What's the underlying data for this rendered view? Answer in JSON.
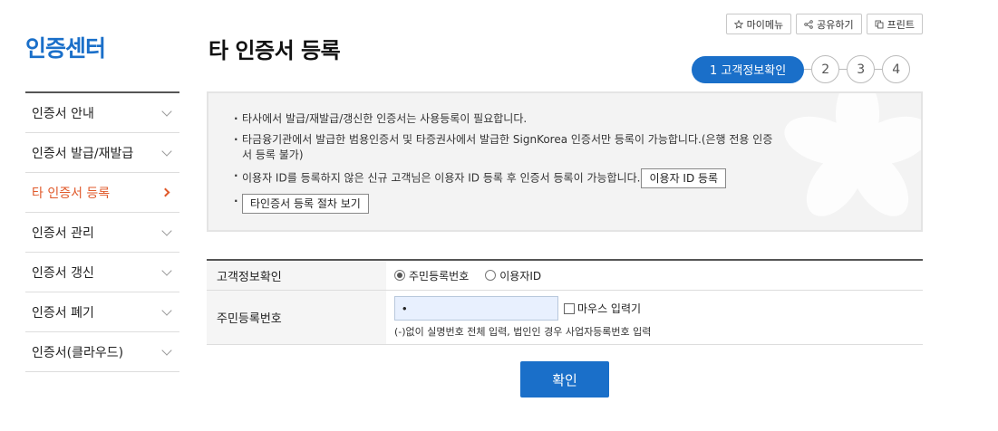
{
  "sidebar": {
    "title": "인증센터",
    "items": [
      {
        "label": "인증서 안내"
      },
      {
        "label": "인증서 발급/재발급"
      },
      {
        "label": "타 인증서 등록"
      },
      {
        "label": "인증서 관리"
      },
      {
        "label": "인증서 갱신"
      },
      {
        "label": "인증서 폐기"
      },
      {
        "label": "인증서(클라우드)"
      }
    ],
    "active_index": 2
  },
  "header": {
    "title": "타 인증서 등록",
    "utility": {
      "my_menu": "마이메뉴",
      "share": "공유하기",
      "print": "프린트"
    }
  },
  "steps": {
    "active_label": "1 고객정보확인",
    "others": [
      "2",
      "3",
      "4"
    ]
  },
  "notice": {
    "line1": "타사에서 발급/재발급/갱신한 인증서는 사용등록이 필요합니다.",
    "line2": "타금융기관에서 발급한 범용인증서 및 타증권사에서 발급한 SignKorea 인증서만 등록이 가능합니다.(은행 전용 인증서 등록 불가)",
    "line3": "이용자 ID를 등록하지 않은 신규 고객님은 이용자 ID 등록 후 인증서 등록이 가능합니다.",
    "user_id_button": "이용자 ID 등록",
    "procedure_button": "타인증서 등록 절차 보기"
  },
  "form": {
    "row1_label": "고객정보확인",
    "radio_option1": "주민등록번호",
    "radio_option2": "이용자ID",
    "selected_option": "주민등록번호",
    "row2_label": "주민등록번호",
    "rrn_value": "•",
    "mouse_input_label": "마우스 입력기",
    "mouse_input_checked": false,
    "hint": "(-)없이 실명번호 전체 입력, 법인인 경우 사업자등록번호 입력"
  },
  "confirm_label": "확인",
  "colors": {
    "accent": "#1a6fc9",
    "active_nav": "#e05a2b"
  }
}
